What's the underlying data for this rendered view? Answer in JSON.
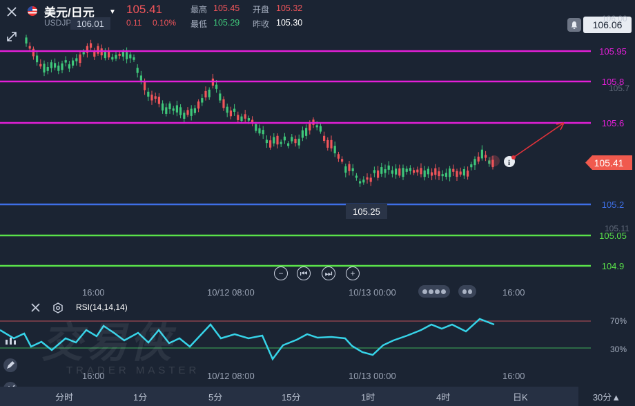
{
  "header": {
    "pair_name": "美元/日元",
    "symbol": "USDJPY",
    "last_price": "105.41",
    "change": "0.11",
    "change_pct": "0.10%",
    "high_label": "最高",
    "high_value": "105.45",
    "open_label": "开盘",
    "open_value": "105.32",
    "low_label": "最低",
    "low_value": "105.29",
    "prev_close_label": "昨收",
    "prev_close_value": "105.30",
    "alert_price": "106.06"
  },
  "chart": {
    "axis_top_value": "106.00",
    "mid_axis_value": "105.7",
    "low_axis_value": "105.11",
    "high_marker": "106.01",
    "low_marker": "105.25",
    "current_price": "105.41",
    "levels": [
      {
        "label": "105.95",
        "color": "#e41fd8"
      },
      {
        "label": "105.8",
        "color": "#e41fd8"
      },
      {
        "label": "105.6",
        "color": "#e41fd8"
      },
      {
        "label": "105.2",
        "color": "#3e6fe6"
      },
      {
        "label": "105.05",
        "color": "#5ae34a"
      },
      {
        "label": "104.9",
        "color": "#5ae34a"
      }
    ],
    "time_labels": [
      "16:00",
      "10/12 08:00",
      "10/13 00:00",
      "16:00"
    ]
  },
  "rsi": {
    "title": "RSI(14,14,14)",
    "upper": "70%",
    "lower": "30%",
    "time_labels": [
      "16:00",
      "10/12 08:00",
      "10/13 00:00",
      "16:00"
    ]
  },
  "watermark": {
    "main": "交易侠",
    "sub": "TRADER MASTER"
  },
  "timeframes": [
    "分时",
    "1分",
    "5分",
    "15分",
    "1时",
    "4时",
    "日K"
  ],
  "timeframe_selected": "30分▲",
  "colors": {
    "up": "#f0555a",
    "down": "#3fc77a",
    "rsi": "#36d3e8",
    "bg": "#1b2433"
  }
}
